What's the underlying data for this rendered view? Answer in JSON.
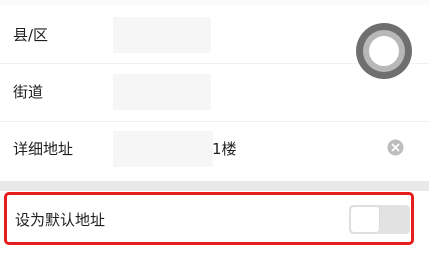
{
  "form": {
    "district": {
      "label": "县/区",
      "value_partial": ""
    },
    "street": {
      "label": "街道",
      "value_partial": ""
    },
    "detail": {
      "label": "详细地址",
      "value_partial": "1楼"
    }
  },
  "default_address": {
    "label": "设为默认地址",
    "enabled": false
  },
  "colors": {
    "highlight": "#e51d1d",
    "switch_track": "#e2e2e2",
    "page_background": "#e9e9e9"
  },
  "icons": {
    "clear": "clear-circle-icon",
    "floating": "floating-ball-icon"
  }
}
